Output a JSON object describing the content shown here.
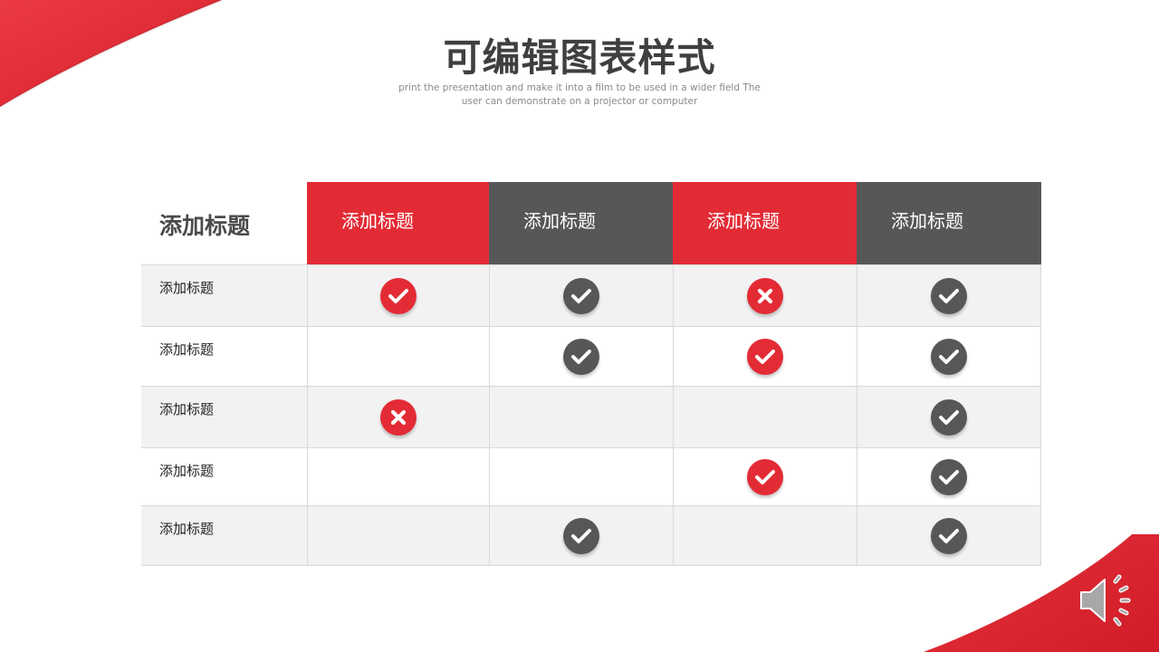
{
  "slide": {
    "title": "可编辑图表样式",
    "subtitle": "print the presentation and make it into a film to be used in a wider field The user can demonstrate on a projector or computer"
  },
  "colors": {
    "accent_red": "#e32b35",
    "dark_gray": "#575757",
    "row_shade": "#f2f2f2",
    "grid_line": "#d9d9d9"
  },
  "table": {
    "corner_label": "添加标题",
    "columns": [
      {
        "label": "添加标题",
        "color": "red"
      },
      {
        "label": "添加标题",
        "color": "dark"
      },
      {
        "label": "添加标题",
        "color": "red"
      },
      {
        "label": "添加标题",
        "color": "dark"
      }
    ],
    "rows": [
      {
        "label": "添加标题",
        "shaded": true,
        "marks": [
          {
            "type": "check",
            "color": "red"
          },
          {
            "type": "check",
            "color": "dark"
          },
          {
            "type": "cross",
            "color": "red"
          },
          {
            "type": "check",
            "color": "dark"
          }
        ]
      },
      {
        "label": "添加标题",
        "shaded": false,
        "marks": [
          null,
          {
            "type": "check",
            "color": "dark"
          },
          {
            "type": "check",
            "color": "red"
          },
          {
            "type": "check",
            "color": "dark"
          }
        ]
      },
      {
        "label": "添加标题",
        "shaded": true,
        "marks": [
          {
            "type": "cross",
            "color": "red"
          },
          null,
          null,
          {
            "type": "check",
            "color": "dark"
          }
        ]
      },
      {
        "label": "添加标题",
        "shaded": false,
        "marks": [
          null,
          null,
          {
            "type": "check",
            "color": "red"
          },
          {
            "type": "check",
            "color": "dark"
          }
        ]
      },
      {
        "label": "添加标题",
        "shaded": true,
        "marks": [
          null,
          {
            "type": "check",
            "color": "dark"
          },
          null,
          {
            "type": "check",
            "color": "dark"
          }
        ]
      }
    ]
  },
  "icons": {
    "check": "check-icon",
    "cross": "cross-icon",
    "speaker": "speaker-icon"
  }
}
